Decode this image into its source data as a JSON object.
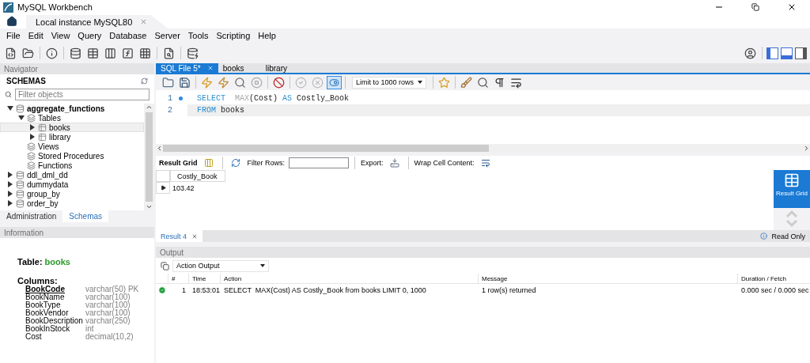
{
  "window": {
    "title": "MySQL Workbench"
  },
  "connection_tabs": [
    {
      "label": "Local instance MySQL80",
      "selected": true
    }
  ],
  "menu": [
    "File",
    "Edit",
    "View",
    "Query",
    "Database",
    "Server",
    "Tools",
    "Scripting",
    "Help"
  ],
  "navigator": {
    "title": "Navigator",
    "section": "SCHEMAS",
    "filter": {
      "placeholder": "Filter objects"
    },
    "tree": [
      {
        "label": "aggregate_functions",
        "kind": "schema",
        "active": true,
        "expanded": true,
        "selected": false,
        "children": [
          {
            "label": "Tables",
            "kind": "folder",
            "expanded": true,
            "selected": false,
            "children": [
              {
                "label": "books",
                "kind": "table",
                "expanded": false,
                "selected": true
              },
              {
                "label": "library",
                "kind": "table",
                "expanded": false,
                "selected": false
              }
            ]
          },
          {
            "label": "Views",
            "kind": "folder",
            "selected": false
          },
          {
            "label": "Stored Procedures",
            "kind": "folder",
            "selected": false
          },
          {
            "label": "Functions",
            "kind": "folder",
            "selected": false
          }
        ]
      },
      {
        "label": "ddl_dml_dd",
        "kind": "schema",
        "active": false,
        "expanded": false,
        "selected": false
      },
      {
        "label": "dummydata",
        "kind": "schema",
        "active": false,
        "expanded": false,
        "selected": false
      },
      {
        "label": "group_by",
        "kind": "schema",
        "active": false,
        "expanded": false,
        "selected": false
      },
      {
        "label": "order_by",
        "kind": "schema",
        "active": false,
        "expanded": false,
        "selected": false
      }
    ],
    "tabs": [
      {
        "label": "Administration",
        "selected": false
      },
      {
        "label": "Schemas",
        "selected": true
      }
    ]
  },
  "information": {
    "title": "Information",
    "table_label": "Table:",
    "table_name": "books",
    "columns_label": "Columns:",
    "columns": [
      {
        "name": "BookCode",
        "type": "varchar(50) PK",
        "primary_key": true
      },
      {
        "name": "BookName",
        "type": "varchar(100)",
        "primary_key": false
      },
      {
        "name": "BookType",
        "type": "varchar(100)",
        "primary_key": false
      },
      {
        "name": "BookVendor",
        "type": "varchar(100)",
        "primary_key": false
      },
      {
        "name": "BookDescription",
        "type": "varchar(250)",
        "primary_key": false
      },
      {
        "name": "BookInStock",
        "type": "int",
        "primary_key": false
      },
      {
        "name": "Cost",
        "type": "decimal(10,2)",
        "primary_key": false
      }
    ]
  },
  "editor": {
    "tabs": [
      {
        "label": "SQL File 5*",
        "selected": true,
        "closable": true
      },
      {
        "label": "books",
        "selected": false,
        "closable": false
      },
      {
        "label": "library",
        "selected": false,
        "closable": false
      }
    ],
    "limit": "Limit to 1000 rows",
    "lines": [
      {
        "number": "1",
        "statement_start": true,
        "current": false,
        "tokens": [
          {
            "kind": "keyword",
            "text": "SELECT  "
          },
          {
            "kind": "function",
            "text": "MAX"
          },
          {
            "kind": "plain",
            "text": "(Cost) "
          },
          {
            "kind": "keyword",
            "text": "AS"
          },
          {
            "kind": "plain",
            "text": " Costly_Book"
          }
        ]
      },
      {
        "number": "2",
        "statement_start": false,
        "current": true,
        "tokens": [
          {
            "kind": "keyword",
            "text": "FROM"
          },
          {
            "kind": "plain",
            "text": " books"
          }
        ]
      }
    ]
  },
  "result": {
    "grid_label": "Result Grid",
    "filter_label": "Filter Rows:",
    "export_label": "Export:",
    "wrap_label": "Wrap Cell Content:",
    "columns": [
      "Costly_Book"
    ],
    "rows": [
      [
        "103.42"
      ]
    ],
    "side_buttons": [
      {
        "label": "Result Grid",
        "selected": true
      }
    ],
    "tabs": [
      {
        "label": "Result 4",
        "selected": true
      }
    ],
    "status": "Read Only"
  },
  "output": {
    "title": "Output",
    "mode": "Action Output",
    "columns": [
      "#",
      "Time",
      "Action",
      "Message",
      "Duration / Fetch"
    ],
    "rows": [
      {
        "success": true,
        "number": "1",
        "time": "18:53:01",
        "action": "SELECT  MAX(Cost) AS Costly_Book from books LIMIT 0, 1000",
        "message": "1 row(s) returned",
        "duration": "0.000 sec / 0.000 sec"
      }
    ]
  }
}
